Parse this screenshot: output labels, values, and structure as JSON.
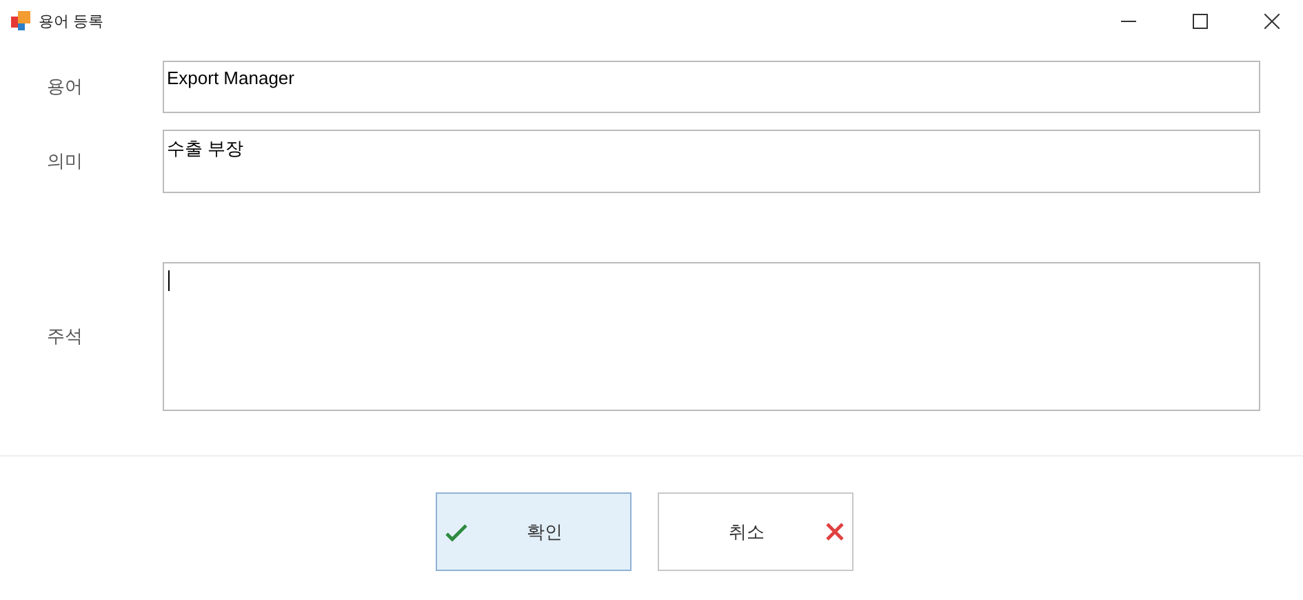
{
  "window": {
    "title": "용어 등록"
  },
  "fields": [
    {
      "label": "용어",
      "value": "Export Manager",
      "kind": "line"
    },
    {
      "label": "의미",
      "value": "수출 부장",
      "kind": "line"
    },
    {
      "label": "주석",
      "kind": "memo",
      "focused": true
    }
  ],
  "buttons": [
    {
      "label": "확인",
      "kind": "confirm",
      "selected": true
    },
    {
      "label": "취소",
      "kind": "cancel",
      "selected": false
    }
  ]
}
